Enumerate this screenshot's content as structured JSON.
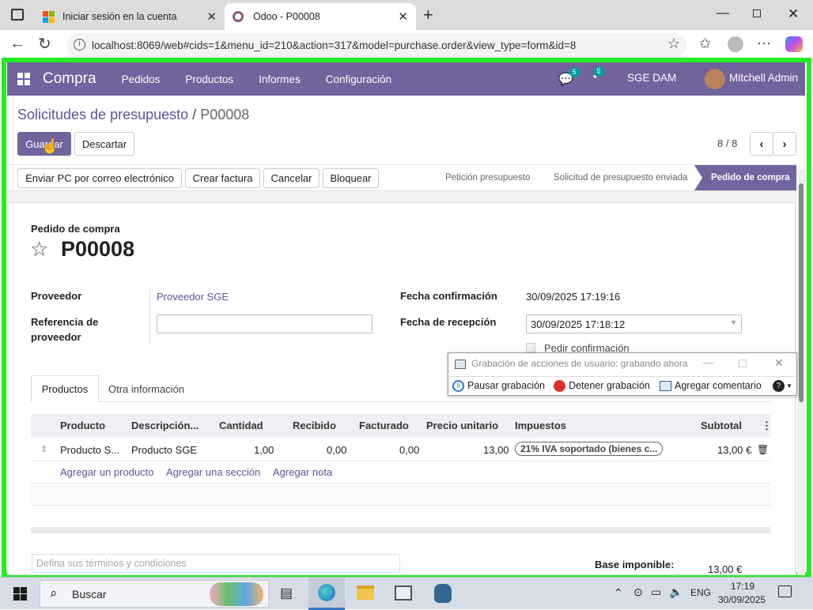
{
  "browser": {
    "tabs": [
      {
        "title": "Iniciar sesión en la cuenta"
      },
      {
        "title": "Odoo - P00008"
      }
    ],
    "url": "localhost:8069/web#cids=1&menu_id=210&action=317&model=purchase.order&view_type=form&id=8"
  },
  "odoo_nav": {
    "app": "Compra",
    "menus": [
      "Pedidos",
      "Productos",
      "Informes",
      "Configuración"
    ],
    "chat_count": "5",
    "activity_count": "5",
    "company": "SGE DAM",
    "user": "Mitchell Admin"
  },
  "breadcrumb": {
    "parent": "Solicitudes de presupuesto",
    "sep": "/",
    "current": "P00008"
  },
  "actions": {
    "save": "Guardar",
    "discard": "Descartar"
  },
  "pager": {
    "text": "8 / 8"
  },
  "status_buttons": [
    "Enviar PC por correo electrónico",
    "Crear factura",
    "Cancelar",
    "Bloquear"
  ],
  "stages": [
    {
      "label": "Petición presupuesto",
      "active": false
    },
    {
      "label": "Solicitud de presupuesto enviada",
      "active": false
    },
    {
      "label": "Pedido de compra",
      "active": true
    }
  ],
  "form": {
    "subtitle": "Pedido de compra",
    "name": "P00008",
    "vendor_label": "Proveedor",
    "vendor_value": "Proveedor SGE",
    "vendor_ref_label_1": "Referencia de",
    "vendor_ref_label_2": "proveedor",
    "vendor_ref_value": "",
    "confirm_date_label": "Fecha confirmación",
    "confirm_date_value": "30/09/2025 17:19:16",
    "receipt_date_label": "Fecha de recepción",
    "receipt_date_value": "30/09/2025 17:18:12",
    "ask_confirm_label": "Pedir confirmación"
  },
  "notebook": {
    "tabs": [
      "Productos",
      "Otra información"
    ]
  },
  "table": {
    "headers": [
      "Producto",
      "Descripción...",
      "Cantidad",
      "Recibido",
      "Facturado",
      "Precio unitario",
      "Impuestos",
      "Subtotal"
    ],
    "rows": [
      {
        "product": "Producto S...",
        "description": "Producto SGE",
        "qty": "1,00",
        "received": "0,00",
        "invoiced": "0,00",
        "price": "13,00",
        "tax": "21% IVA soportado (bienes c...",
        "subtotal": "13,00 €"
      }
    ],
    "add_links": [
      "Agregar un producto",
      "Agregar una sección",
      "Agregar nota"
    ]
  },
  "footer": {
    "terms_placeholder": "Defina sus términos y condiciones",
    "base_label": "Base imponible:",
    "base_value": "13,00 €"
  },
  "recorder": {
    "title": "Grabación de acciones de usuario: grabando ahora",
    "pause": "Pausar grabación",
    "stop": "Detener grabación",
    "comment": "Agregar comentario"
  },
  "taskbar": {
    "search": "Buscar",
    "lang": "ENG",
    "time": "17:19",
    "date": "30/09/2025"
  },
  "colors": {
    "odoo_primary": "#71639e",
    "frame_green": "#22ee22",
    "link": "#5c5399"
  }
}
